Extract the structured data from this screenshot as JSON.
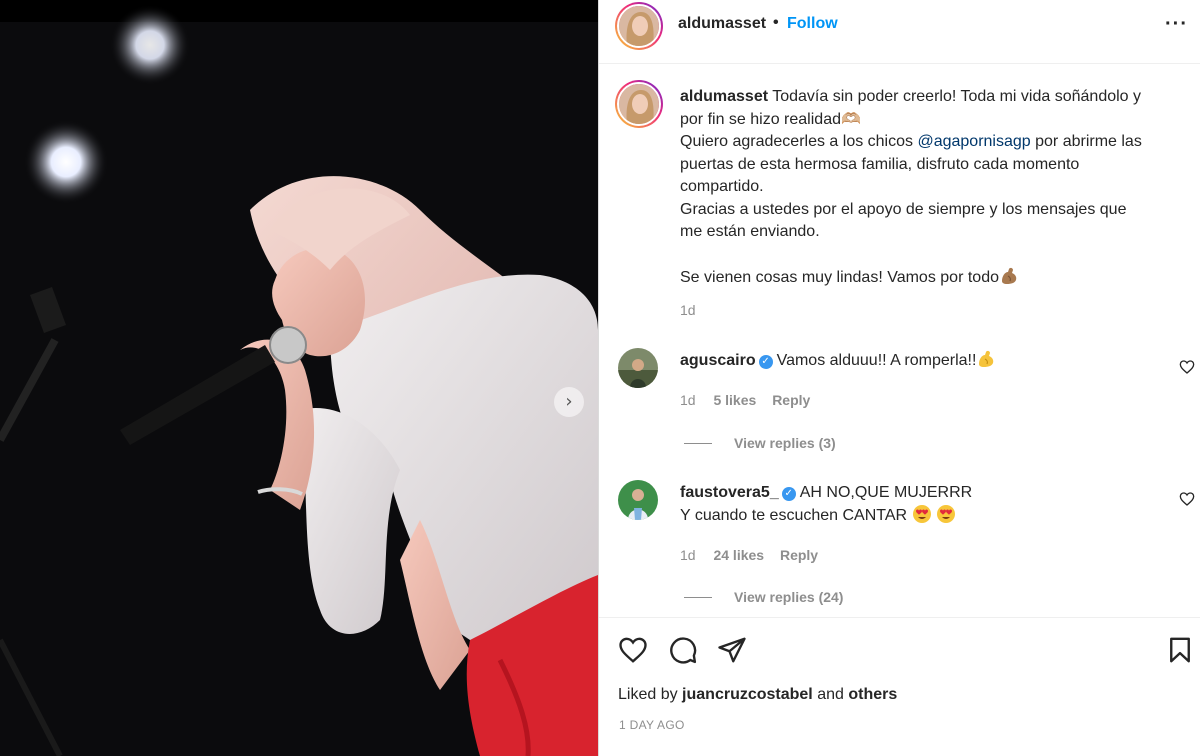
{
  "post": {
    "username": "aldumasset",
    "follow_label": "Follow",
    "header_dot": "•",
    "more_icon": "more-horizontal-icon",
    "caption_lines": [
      "Todavía sin poder creerlo! Toda mi vida soñándolo y",
      "por fin se hizo realidad🫶🏼"
    ],
    "caption_mention_prefix": "Quiero agradecerles a los chicos ",
    "caption_mention": "@agapornisagp",
    "caption_mention_suffix": " por abrirme las",
    "caption_lines_2": [
      "puertas de esta hermosa familia, disfruto cada momento",
      "compartido.",
      "Gracias a ustedes por el apoyo de siempre y los mensajes que",
      "me están enviando.",
      "",
      "Se vienen cosas muy lindas! Vamos por todo"
    ],
    "caption_time": "1d"
  },
  "comments": [
    {
      "username": "aguscairo",
      "verified": true,
      "text": "Vamos alduuu!! A romperla!!",
      "time": "1d",
      "likes": "5 likes",
      "reply_label": "Reply",
      "view_replies": "View replies (3)"
    },
    {
      "username": "faustovera5_",
      "verified": true,
      "text": "AH NO,QUE MUJERRR",
      "text_line2": "Y cuando te escuchen CANTAR",
      "time": "1d",
      "likes": "24 likes",
      "reply_label": "Reply",
      "view_replies": "View replies (24)"
    }
  ],
  "footer": {
    "liked_prefix": "Liked by ",
    "liked_user": "juancruzcostabel",
    "liked_and": " and ",
    "liked_others": "others",
    "ago": "1 DAY AGO"
  },
  "icons": {
    "like": "heart-icon",
    "comment": "comment-icon",
    "share": "send-icon",
    "save": "bookmark-icon",
    "next": "chevron-right-icon"
  },
  "colors": {
    "follow": "#0095f6",
    "mention": "#00376b",
    "verified": "#3897f0",
    "muted": "#8e8e8e"
  }
}
